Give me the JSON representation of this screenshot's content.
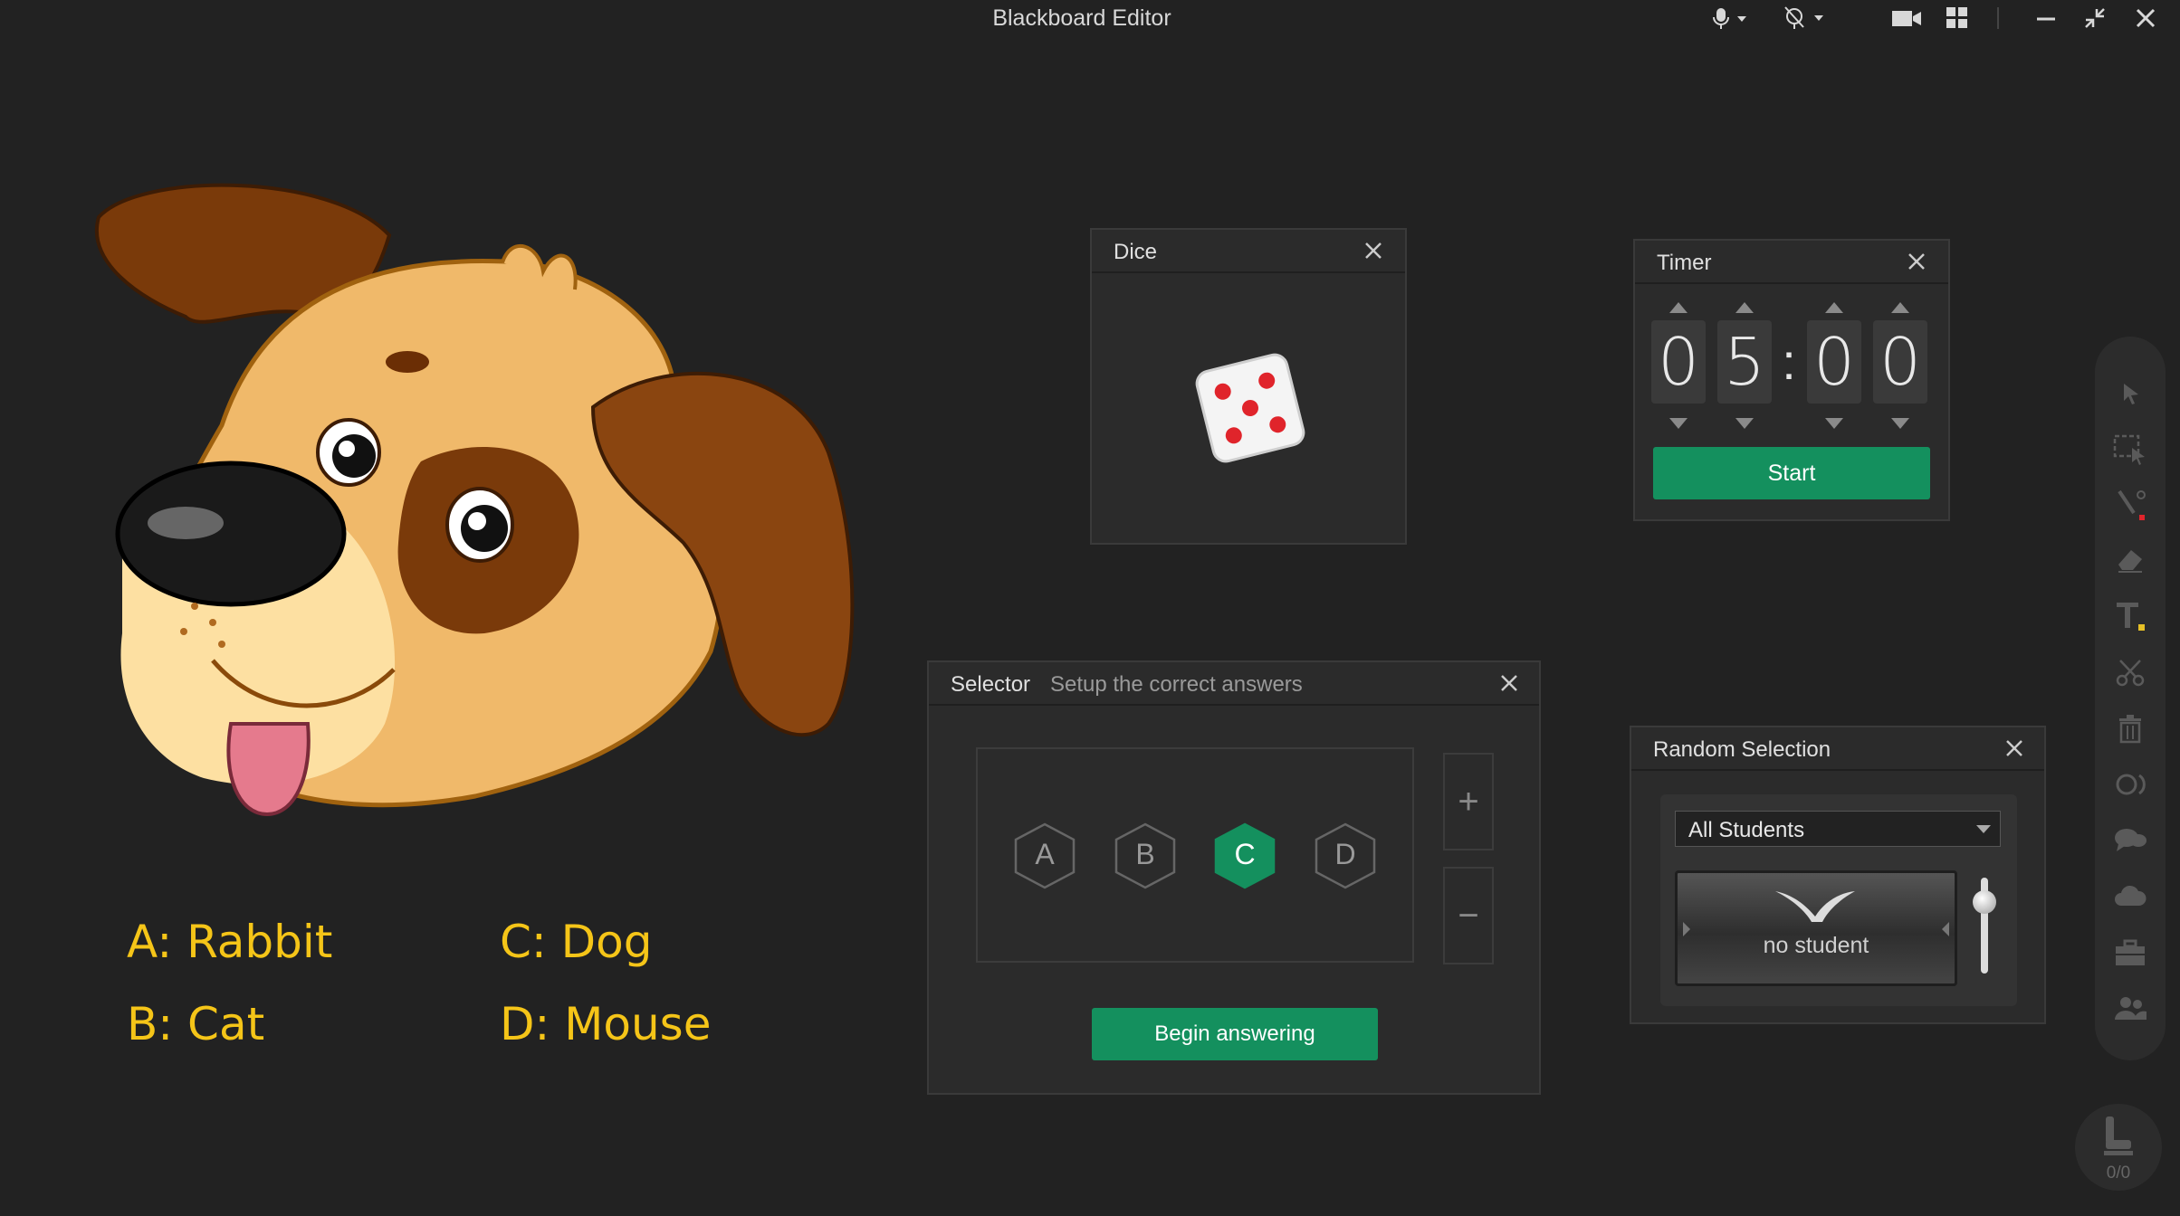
{
  "window": {
    "title": "Blackboard Editor"
  },
  "answers": [
    {
      "text": "A: Rabbit"
    },
    {
      "text": "C: Dog"
    },
    {
      "text": "B: Cat"
    },
    {
      "text": "D: Mouse"
    }
  ],
  "dice": {
    "title": "Dice",
    "face": 5
  },
  "timer": {
    "title": "Timer",
    "digits": [
      "0",
      "5",
      "0",
      "0"
    ],
    "separator": ":",
    "start_label": "Start"
  },
  "selector": {
    "title": "Selector",
    "subtitle": "Setup the correct answers",
    "options": [
      {
        "label": "A",
        "selected": false
      },
      {
        "label": "B",
        "selected": false
      },
      {
        "label": "C",
        "selected": true
      },
      {
        "label": "D",
        "selected": false
      }
    ],
    "add_label": "+",
    "remove_label": "−",
    "begin_label": "Begin answering"
  },
  "random": {
    "title": "Random Selection",
    "dropdown_value": "All Students",
    "result": "no student"
  },
  "seat": {
    "count": "0/0"
  },
  "colors": {
    "accent": "#14905e",
    "answer_text": "#f5c518",
    "dice_dot": "#e0242b"
  }
}
